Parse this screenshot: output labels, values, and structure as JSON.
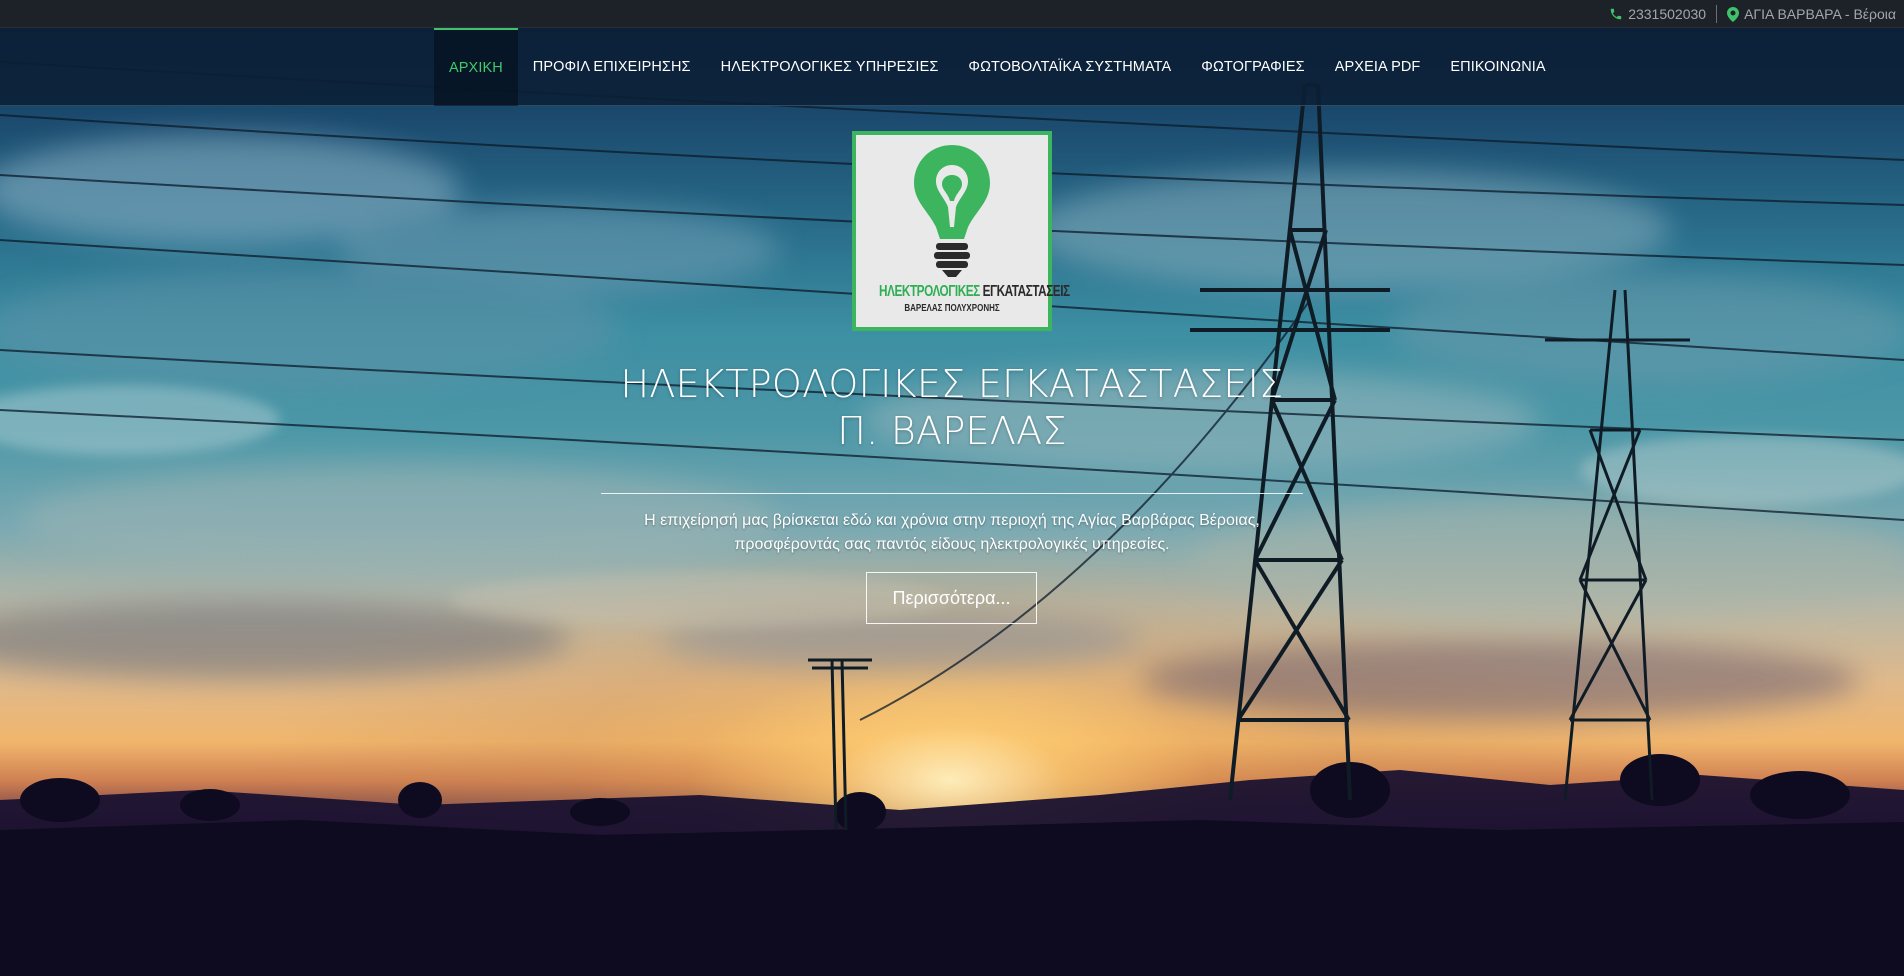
{
  "topbar": {
    "phone": "2331502030",
    "location": "ΑΓΙΑ ΒΑΡΒΑΡΑ - Βέροια",
    "phone_icon": "phone-icon",
    "location_icon": "map-marker-icon"
  },
  "nav": {
    "items": [
      {
        "label": "ΑΡΧΙΚΗ",
        "active": true
      },
      {
        "label": "ΠΡΟΦΙΛ ΕΠΙΧΕΙΡΗΣΗΣ",
        "active": false
      },
      {
        "label": "ΗΛΕΚΤΡΟΛΟΓΙΚΕΣ ΥΠΗΡΕΣΙΕΣ",
        "active": false
      },
      {
        "label": "ΦΩΤΟΒΟΛΤΑΪΚΑ ΣΥΣΤΗΜΑΤΑ",
        "active": false
      },
      {
        "label": "ΦΩΤΟΓΡΑΦΙΕΣ",
        "active": false
      },
      {
        "label": "ΑΡΧΕΙΑ PDF",
        "active": false
      },
      {
        "label": "ΕΠΙΚΟΙΝΩΝΙΑ",
        "active": false
      }
    ]
  },
  "logo": {
    "line1_green": "ΗΛΕΚΤΡΟΛΟΓΙΚΕΣ",
    "line1_dark": "ΕΓΚΑΤΑΣΤΑΣΕΙΣ",
    "line2": "ΒΑΡΕΛΑΣ ΠΟΛΥΧΡΟΝΗΣ",
    "icon": "lightbulb-icon"
  },
  "hero": {
    "title_line1": "ΗΛΕΚΤΡΟΛΟΓΙΚΕΣ ΕΓΚΑΤΑΣΤΑΣΕΙΣ",
    "title_line2": "Π. ΒΑΡΕΛΑΣ",
    "desc_line1": "Η επιχείρησή μας βρίσκεται εδώ και χρόνια στην περιοχή της Αγίας Βαρβάρας Βέροιας,",
    "desc_line2": "προσφέροντάς σας παντός είδους ηλεκτρολογικές υπηρεσίες.",
    "button_label": "Περισσότερα..."
  },
  "colors": {
    "accent": "#3fc26a",
    "topbar_bg": "#1d2128",
    "navbar_bg": "#0b1e34"
  }
}
